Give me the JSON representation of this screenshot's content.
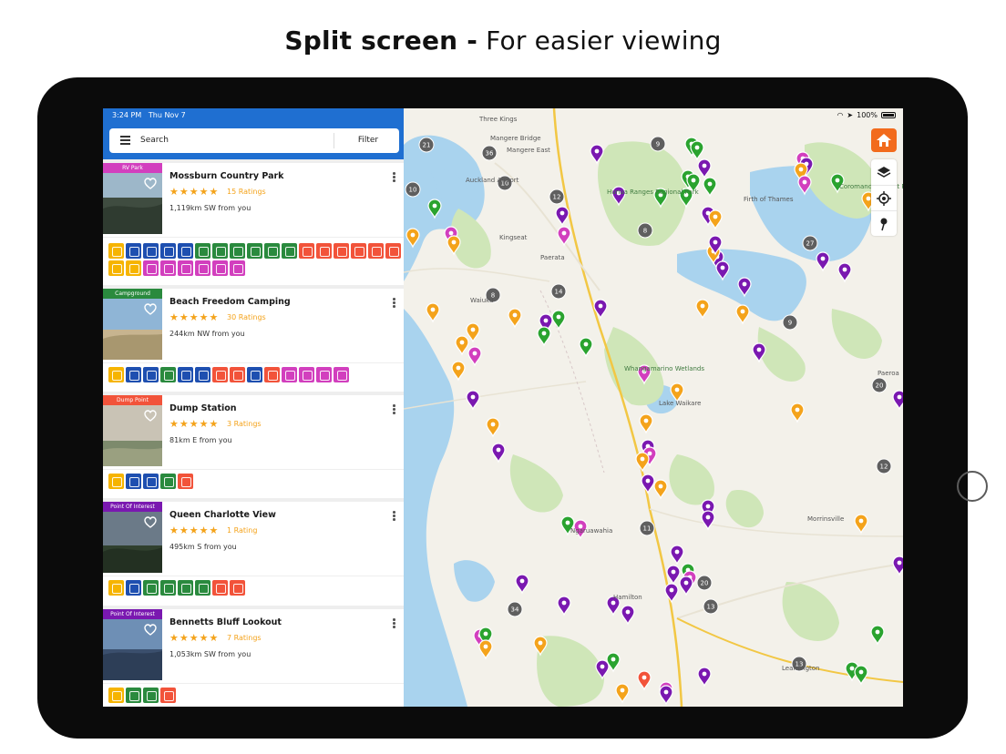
{
  "headline": {
    "bold": "Split screen -",
    "rest": " For easier viewing"
  },
  "status": {
    "time": "3:24 PM",
    "date": "Thu Nov 7",
    "battery": "100%"
  },
  "search": {
    "label": "Search",
    "filter_label": "Filter"
  },
  "colors": {
    "brand_blue": "#1f6fd1",
    "star": "#f4a31b",
    "home_orange": "#f26b1d",
    "poi_purple": "#7a18b0",
    "camp_green": "#2aa32f",
    "dump_red": "#f2533a",
    "rv_pink": "#d23fbe"
  },
  "listings": [
    {
      "category": "RV Park",
      "category_color": "#d23fbe",
      "name": "Mossburn Country Park",
      "stars": 5,
      "rating_text": "15 Ratings",
      "distance": "1,119km SW from you",
      "amenities": [
        "#f6b400",
        "#1e4fb0",
        "#1e4fb0",
        "#1e4fb0",
        "#1e4fb0",
        "#2a8a3e",
        "#2a8a3e",
        "#2a8a3e",
        "#2a8a3e",
        "#2a8a3e",
        "#2a8a3e",
        "#f2533a",
        "#f2533a",
        "#f2533a",
        "#f2533a",
        "#f2533a",
        "#f2533a",
        "#f6b400",
        "#f6b400",
        "#d23fbe",
        "#d23fbe",
        "#d23fbe",
        "#d23fbe",
        "#d23fbe",
        "#d23fbe"
      ]
    },
    {
      "category": "Campground",
      "category_color": "#2a8a3e",
      "name": "Beach Freedom Camping",
      "stars": 5,
      "rating_text": "30 Ratings",
      "distance": "244km NW from you",
      "amenities": [
        "#f6b400",
        "#1e4fb0",
        "#1e4fb0",
        "#2a8a3e",
        "#1e4fb0",
        "#1e4fb0",
        "#f2533a",
        "#f2533a",
        "#1e4fb0",
        "#f2533a",
        "#d23fbe",
        "#d23fbe",
        "#d23fbe",
        "#d23fbe"
      ]
    },
    {
      "category": "Dump Point",
      "category_color": "#f2533a",
      "name": "Dump Station",
      "stars": 5,
      "rating_text": "3 Ratings",
      "distance": "81km E from you",
      "amenities": [
        "#f6b400",
        "#1e4fb0",
        "#1e4fb0",
        "#2a8a3e",
        "#f2533a"
      ]
    },
    {
      "category": "Point Of Interest",
      "category_color": "#7a18b0",
      "name": "Queen Charlotte View",
      "stars": 5,
      "rating_text": "1 Rating",
      "distance": "495km S from you",
      "amenities": [
        "#f6b400",
        "#1e4fb0",
        "#2a8a3e",
        "#2a8a3e",
        "#2a8a3e",
        "#2a8a3e",
        "#f2533a",
        "#f2533a"
      ]
    },
    {
      "category": "Point Of Interest",
      "category_color": "#7a18b0",
      "name": "Bennetts Bluff Lookout",
      "stars": 5,
      "rating_text": "7 Ratings",
      "distance": "1,053km SW from you",
      "amenities": [
        "#f6b400",
        "#2a8a3e",
        "#2a8a3e",
        "#f2533a"
      ]
    }
  ],
  "map_labels": [
    {
      "text": "Three Kings"
    },
    {
      "text": "Mangere Bridge"
    },
    {
      "text": "Mangere East"
    },
    {
      "text": "Auckland Airport"
    },
    {
      "text": "Kingseat"
    },
    {
      "text": "Paerata"
    },
    {
      "text": "Waiuku"
    },
    {
      "text": "Hunua Ranges Regional Park",
      "green": true
    },
    {
      "text": "Firth of Thames"
    },
    {
      "text": "Coromandel Forest Park",
      "green": true
    },
    {
      "text": "Whangamarino Wetlands",
      "green": true
    },
    {
      "text": "Lake Waikare"
    },
    {
      "text": "Ngaruawahia"
    },
    {
      "text": "Morrinsville"
    },
    {
      "text": "Hamilton"
    },
    {
      "text": "Paeroa"
    },
    {
      "text": "Leamington"
    }
  ]
}
